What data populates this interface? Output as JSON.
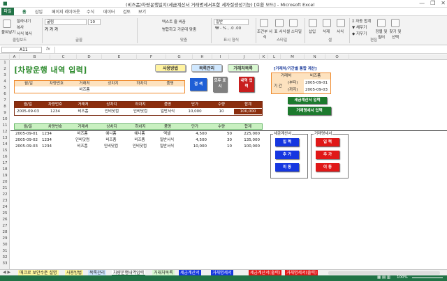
{
  "window": {
    "title": "(비즈폼)차량운행일지(세금계산서 거래명세서포함 세자질생성기능) [호환 모드] - Microsoft Excel"
  },
  "ribbon_tabs": [
    "파일",
    "홈",
    "삽입",
    "페이지 레이아웃",
    "수식",
    "데이터",
    "검토",
    "보기"
  ],
  "ribbon": {
    "clipboard": {
      "paste": "붙여넣기",
      "cut": "잘라내기",
      "copy": "복사",
      "format_painter": "서식 복사",
      "group": "클립보드"
    },
    "font": {
      "name": "굴림",
      "size": "10",
      "group": "글꼴"
    },
    "alignment": {
      "wrap": "텍스트 줄 바꿈",
      "merge": "병합하고 가운데 맞춤",
      "group": "맞춤"
    },
    "number": {
      "format": "일반",
      "group": "표시 형식"
    },
    "styles": {
      "conditional": "조건부 서식",
      "table": "표 서식",
      "cell": "셀 스타일",
      "group": "스타일"
    },
    "cells": {
      "insert": "삽입",
      "delete": "삭제",
      "format": "서식",
      "group": "셀"
    },
    "editing": {
      "autosum": "자동 합계",
      "fill": "채우기",
      "clear": "지우기",
      "sort": "정렬 및 필터",
      "find": "찾기 및 선택",
      "group": "편집"
    }
  },
  "formula_bar": {
    "cell_ref": "A11",
    "fx": "fx",
    "value": ""
  },
  "columns": [
    "A",
    "B",
    "C",
    "D",
    "E",
    "F",
    "G",
    "H",
    "I",
    "J",
    "K",
    "L",
    "M",
    "N",
    "O"
  ],
  "rows": [
    "1",
    "2",
    "3",
    "4",
    "5",
    "6",
    "7",
    "8",
    "9",
    "10",
    "11",
    "12",
    "13",
    "14",
    "15",
    "16",
    "17",
    "18",
    "19",
    "20",
    "21",
    "22",
    "23",
    "24",
    "25",
    "26",
    "27",
    "28",
    "29",
    "30",
    "31",
    "32",
    "33"
  ],
  "sheet": {
    "title": "[차량운행 내역 입력]",
    "nav": {
      "usage": "사용방법",
      "list_mgmt": "목록관리",
      "trade_list": "거래처목록"
    },
    "search_headers": [
      "월/일",
      "차량번호",
      "거래처",
      "상차지",
      "하차지",
      "품명"
    ],
    "search_values": [
      "",
      "",
      "비즈폼",
      "",
      "",
      ""
    ],
    "btn_search": "검 색",
    "btn_show_all": "모두 표시",
    "btn_input_detail": "내역 입력",
    "period_title": "[거래처/기간별 통합 계산]",
    "period": {
      "client_label": "거래처",
      "client_value": "비즈폼",
      "period_label": "기 간",
      "from_label": "(부터)",
      "from_value": "2005-09-01",
      "to_label": "(까지)",
      "to_value": "2005-09-03"
    },
    "btn_tax_invoice": "세금계산서 입력",
    "btn_trade_statement": "거래명세서 입력",
    "entry_headers": [
      "월/일",
      "차량번호",
      "거래처",
      "상차지",
      "하차지",
      "품명",
      "단가",
      "수량",
      "합계"
    ],
    "entry_row": [
      "2005-09-03",
      "1234",
      "비즈폼",
      "인비닷컴",
      "인비닷컴",
      "일반서식",
      "10,000",
      "10",
      "100,000"
    ],
    "list_headers": [
      "월/일",
      "차량번호",
      "거래처",
      "상차지",
      "하차지",
      "품명",
      "단가",
      "수량",
      "합계"
    ],
    "list_rows": [
      [
        "2005-09-01",
        "1234",
        "비즈폼",
        "예니폼",
        "예니폼",
        "엑셀",
        "4,500",
        "50",
        "225,000"
      ],
      [
        "2005-09-02",
        "1234",
        "인비닷컴",
        "비즈폼",
        "비즈폼",
        "일반서식",
        "4,500",
        "30",
        "135,000"
      ],
      [
        "2005-09-03",
        "1234",
        "비즈폼",
        "인비닷컴",
        "인비닷컴",
        "일반서식",
        "10,000",
        "10",
        "100,000"
      ]
    ],
    "tax_panel": {
      "title": "세금계산서",
      "input": "입 력",
      "add": "추 가",
      "move": "이 동"
    },
    "trade_panel": {
      "title": "거래명세서",
      "input": "입 력",
      "add": "추 가",
      "move": "이 동"
    }
  },
  "sheet_tabs": [
    "매크로 보안수준 설명",
    "사용방법",
    "목록관리",
    "차량운행내역입력",
    "거래처목록",
    "세금계산서",
    "거래명세서",
    "세금계산서(출력)",
    "거래명세서(출력)"
  ],
  "status": {
    "zoom": "100%"
  }
}
